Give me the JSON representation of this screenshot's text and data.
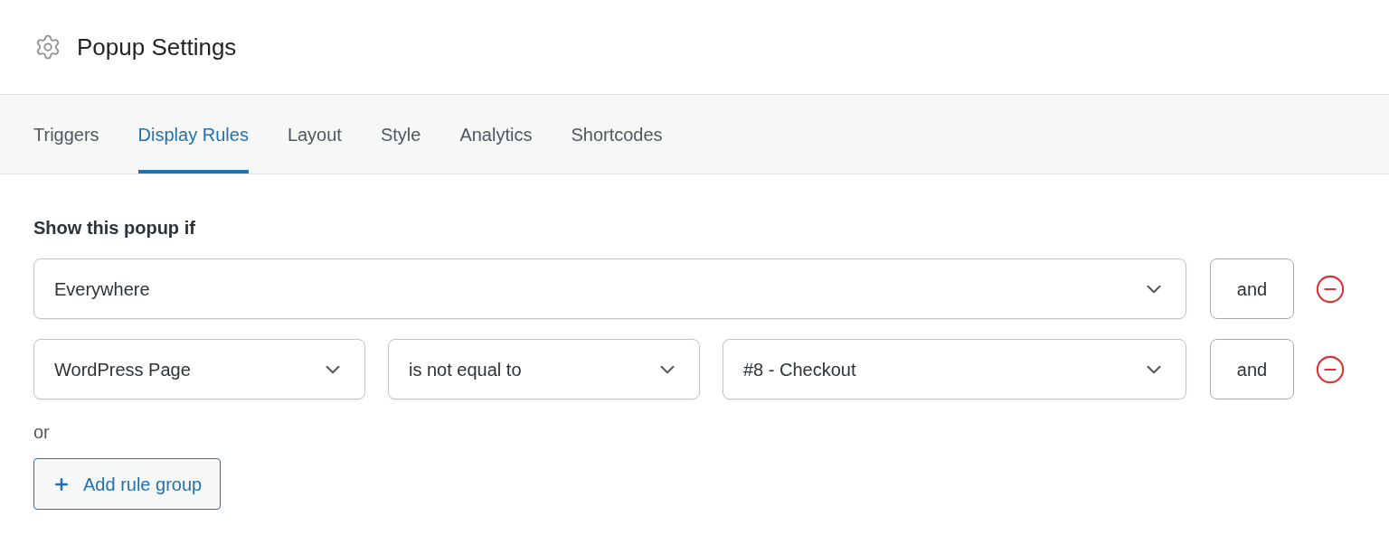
{
  "header": {
    "title": "Popup Settings"
  },
  "tabs": [
    {
      "label": "Triggers",
      "selected": false
    },
    {
      "label": "Display Rules",
      "selected": true
    },
    {
      "label": "Layout",
      "selected": false
    },
    {
      "label": "Style",
      "selected": false
    },
    {
      "label": "Analytics",
      "selected": false
    },
    {
      "label": "Shortcodes",
      "selected": false
    }
  ],
  "rules": {
    "heading": "Show this popup if",
    "conditions": [
      {
        "fields": [
          {
            "value": "Everywhere"
          }
        ],
        "connector": "and"
      },
      {
        "fields": [
          {
            "value": "WordPress Page"
          },
          {
            "value": "is not equal to"
          },
          {
            "value": "#8 - Checkout"
          }
        ],
        "connector": "and"
      }
    ],
    "or_label": "or",
    "add_button": "Add rule group"
  }
}
